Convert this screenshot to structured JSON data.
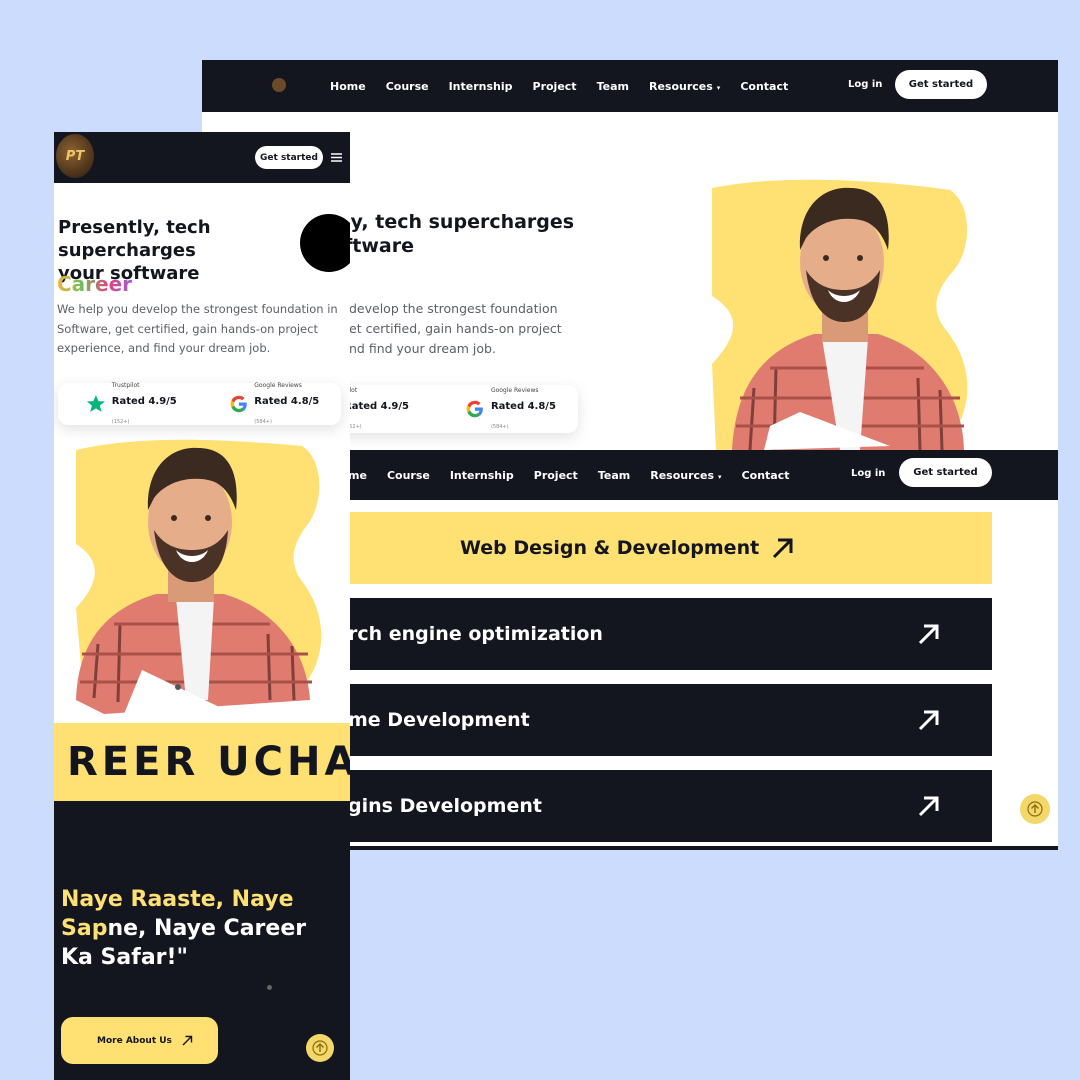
{
  "logo_text": "PT",
  "nav": {
    "items": [
      "Home",
      "Course",
      "Internship",
      "Project",
      "Team",
      "Resources",
      "Contact"
    ],
    "resources_caret": "▾",
    "login": "Log in",
    "get_started": "Get started"
  },
  "hero": {
    "title_line1": "Presently, tech supercharges",
    "title_line2": "your software",
    "desk_title_line1": "ly, tech supercharges",
    "desk_title_line2": "ftware",
    "rotating_word": "Career",
    "desc_line1": "We help you develop the strongest foundation in",
    "desc_line2": "Software, get certified, gain hands-on project",
    "desc_line3": "experience, and find your dream job.",
    "desk_desc_line1": "develop the strongest foundation",
    "desk_desc_line2": "et certified, gain hands-on project",
    "desk_desc_line3": "nd find your dream job."
  },
  "ratings": {
    "trustpilot_label": "Trustpilot",
    "trustpilot_value": "Rated 4.9/5",
    "trustpilot_count": "(152+)",
    "desk_trustpilot_label": "pilot",
    "desk_trustpilot_value": "Rated 4.9/5",
    "google_label": "Google Reviews",
    "google_value": "Rated 4.8/5",
    "google_count": "(584+)"
  },
  "desk_nav2_items": [
    "me",
    "Course",
    "Internship",
    "Project",
    "Team",
    "Resources",
    "Contact"
  ],
  "services": [
    {
      "label": "Web Design & Development",
      "theme": "yellow"
    },
    {
      "label": "rch engine optimization",
      "theme": "dark"
    },
    {
      "label": "me Development",
      "theme": "dark"
    },
    {
      "label": "gins Development",
      "theme": "dark"
    }
  ],
  "marquee": "REER UCHA",
  "tagline": {
    "line1_yellow": "Naye Raaste, Naye",
    "line2_yellow": "Sap",
    "line2_white": "ne, Naye Career",
    "line3": "Ka Safar!\""
  },
  "more_about": "More About Us",
  "colors": {
    "background": "#cbdcfc",
    "dark": "#13151f",
    "accent_yellow": "#ffe073",
    "scroll_button": "#f3d769",
    "trustpilot_green": "#00b67a"
  },
  "icons": [
    "logo-icon",
    "star-icon",
    "google-icon",
    "arrow-up-right-icon",
    "hamburger-icon",
    "arrow-up-icon"
  ]
}
